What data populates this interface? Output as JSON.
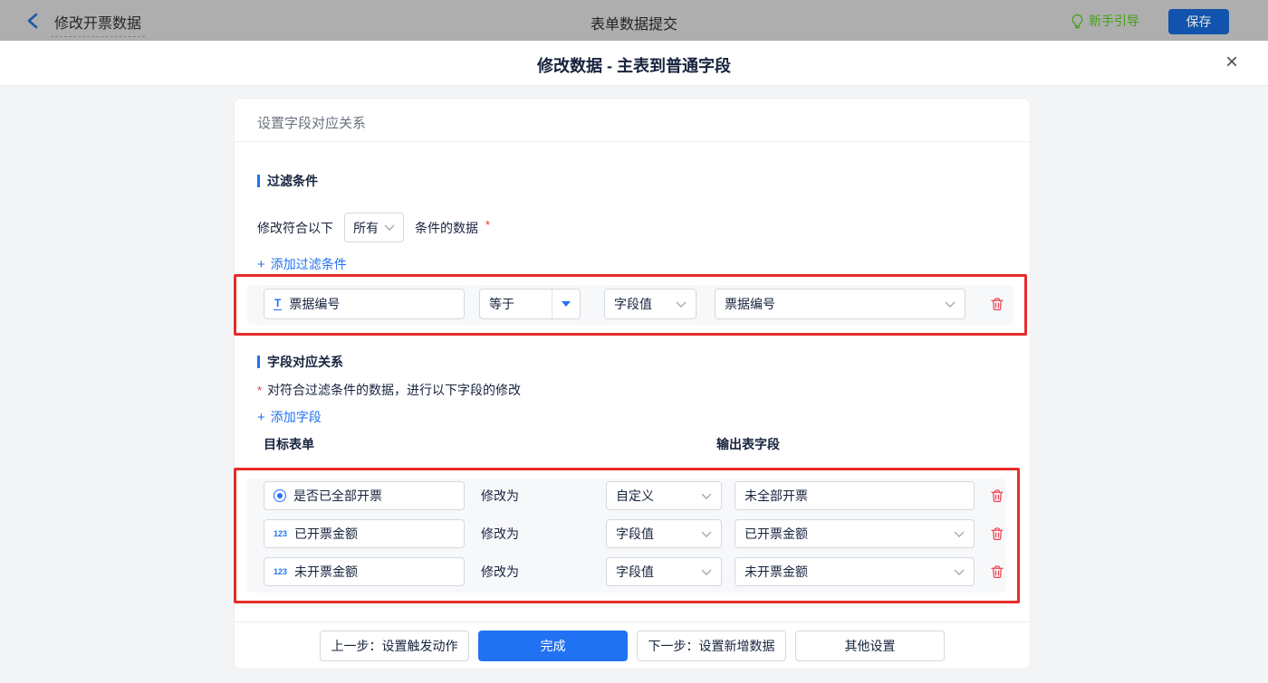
{
  "topbar": {
    "back_label": "修改开票数据",
    "center_title": "表单数据提交",
    "guide_label": "新手引导",
    "save_label": "保存"
  },
  "dialog": {
    "title": "修改数据 - 主表到普通字段",
    "close_icon": "×"
  },
  "card": {
    "header": "设置字段对应关系"
  },
  "filter": {
    "section_title": "过滤条件",
    "match_prefix": "修改符合以下",
    "match_value": "所有",
    "match_suffix": "条件的数据",
    "required_mark": "*",
    "add_icon": "+",
    "add_label": "添加过滤条件",
    "row": {
      "field_icon": "T",
      "field_label": "票据编号",
      "operator_value": "等于",
      "type_value": "字段值",
      "value_field": "票据编号"
    }
  },
  "mapping": {
    "section_title": "字段对应关系",
    "required_mark": "*",
    "description": "对符合过滤条件的数据，进行以下字段的修改",
    "add_icon": "+",
    "add_label": "添加字段",
    "target_header": "目标表单",
    "output_header": "输出表字段",
    "modify_label": "修改为",
    "rows": [
      {
        "icon": "radio-icon",
        "icon_text": "",
        "field_label": "是否已全部开票",
        "type_value": "自定义",
        "value": "未全部开票"
      },
      {
        "icon": "number-icon",
        "icon_text": "123",
        "field_label": "已开票金额",
        "type_value": "字段值",
        "value": "已开票金额"
      },
      {
        "icon": "number-icon",
        "icon_text": "123",
        "field_label": "未开票金额",
        "type_value": "字段值",
        "value": "未开票金额"
      }
    ]
  },
  "footer": {
    "prev_label": "上一步：设置触发动作",
    "done_label": "完成",
    "next_label": "下一步：设置新增数据",
    "other_label": "其他设置"
  },
  "colors": {
    "accent_blue": "#2172f2",
    "annotation_red": "#e82b2b",
    "danger_red": "#f0444f",
    "guide_green": "#44a016",
    "save_button_blue": "#1254ad",
    "topbar_gray": "#aeaeae",
    "panel_gray": "#f7f8fa"
  }
}
